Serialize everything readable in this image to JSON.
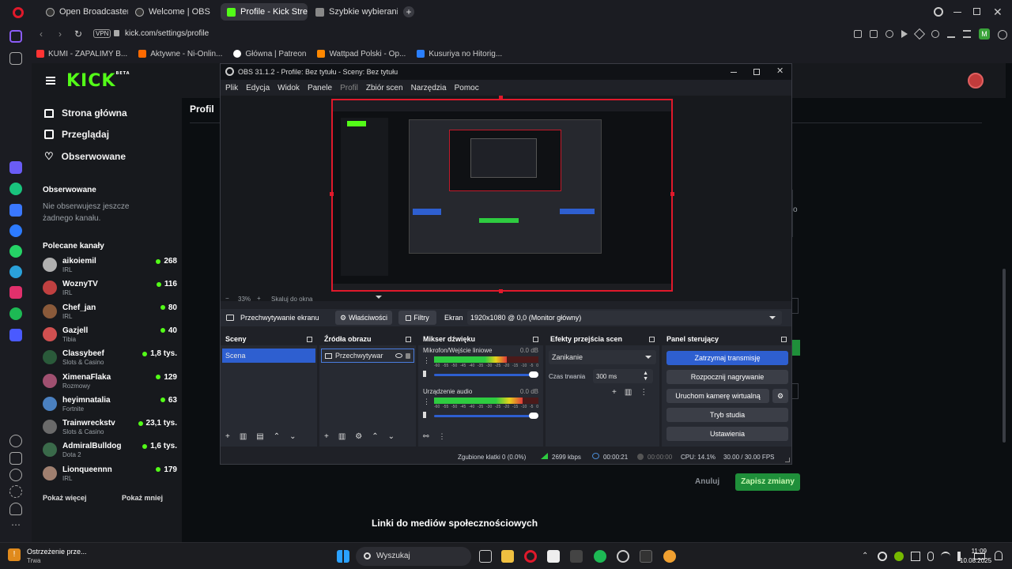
{
  "browser": {
    "tabs": [
      {
        "label": "Open Broadcaster Softw...",
        "active": false
      },
      {
        "label": "Welcome | OBS",
        "active": false
      },
      {
        "label": "Profile - Kick Streaming",
        "active": true
      },
      {
        "label": "Szybkie wybieranie",
        "active": false
      }
    ],
    "url": "kick.com/settings/profile",
    "vpn_label": "VPN",
    "bookmarks": [
      {
        "label": "KUMI - ZAPALIMY B...",
        "color": "#ff3333"
      },
      {
        "label": "Aktywne - Ni-Onlin...",
        "color": "#ff6a00"
      },
      {
        "label": "Główna | Patreon",
        "color": "#ffffff"
      },
      {
        "label": "Wattpad Polski - Op...",
        "color": "#ff8800"
      },
      {
        "label": "Kusuriya no Hitorig...",
        "color": "#2a7fff"
      }
    ]
  },
  "kick": {
    "logo": "KICK",
    "logo_badge": "BETA",
    "nav": [
      {
        "label": "Strona główna",
        "icon": "home-icon"
      },
      {
        "label": "Przeglądaj",
        "icon": "browse-icon"
      },
      {
        "label": "Obserwowane",
        "icon": "heart-icon"
      }
    ],
    "followed_header": "Obserwowane",
    "followed_empty": "Nie obserwujesz jeszcze żadnego kanału.",
    "recommended_header": "Polecane kanały",
    "channels": [
      {
        "name": "aikoiemil",
        "category": "IRL",
        "viewers": "268",
        "color": "#b0b0b0"
      },
      {
        "name": "WoznyTV",
        "category": "IRL",
        "viewers": "116",
        "color": "#c04040"
      },
      {
        "name": "Chef_jan",
        "category": "IRL",
        "viewers": "80",
        "color": "#8a5a3a"
      },
      {
        "name": "Gazjell",
        "category": "Tibia",
        "viewers": "40",
        "color": "#d05050"
      },
      {
        "name": "Classybeef",
        "category": "Slots & Casino",
        "viewers": "1,8 tys.",
        "color": "#2a5a3a"
      },
      {
        "name": "XimenaFlaka",
        "category": "Rozmowy",
        "viewers": "129",
        "color": "#a05070"
      },
      {
        "name": "heyimnatalia",
        "category": "Fortnite",
        "viewers": "63",
        "color": "#4a80c0"
      },
      {
        "name": "Trainwreckstv",
        "category": "Slots & Casino",
        "viewers": "23,1 tys.",
        "color": "#6a6a6a"
      },
      {
        "name": "AdmiralBulldog",
        "category": "Dota 2",
        "viewers": "1,6 tys.",
        "color": "#3a6a4a"
      },
      {
        "name": "Lionqueennn",
        "category": "IRL",
        "viewers": "179",
        "color": "#a08070"
      }
    ],
    "show_more": "Pokaż więcej",
    "show_less": "Pokaż mniej",
    "page_tab": "Profil",
    "cancel": "Anuluj",
    "save": "Zapisz zmiany",
    "social_header": "Linki do mediów społecznościowych",
    "accent": "#53fc18"
  },
  "obs": {
    "title": "OBS 31.1.2 - Profile: Bez tytułu - Sceny: Bez tytułu",
    "menu": [
      "Plik",
      "Edycja",
      "Widok",
      "Panele",
      "Profil",
      "Zbiór scen",
      "Narzędzia",
      "Pomoc"
    ],
    "zoom": "33%",
    "scale": "Skaluj do okna",
    "source_toolbar": {
      "source": "Przechwytywanie ekranu",
      "properties": "Właściwości",
      "filters": "Filtry",
      "screen_label": "Ekran",
      "screen_value": "1920x1080 @ 0,0 (Monitor główny)"
    },
    "docks": {
      "scenes": {
        "title": "Sceny",
        "items": [
          "Scena"
        ]
      },
      "sources": {
        "title": "Źródła obrazu",
        "items": [
          "Przechwytywar"
        ]
      },
      "mixer": {
        "title": "Mikser dźwięku",
        "channels": [
          {
            "name": "Mikrofon/Wejście liniowe",
            "db": "0.0 dB",
            "level": 0.7
          },
          {
            "name": "Urządzenie audio",
            "db": "0.0 dB",
            "level": 0.85
          }
        ],
        "scale": [
          "-60",
          "-55",
          "-50",
          "-45",
          "-40",
          "-35",
          "-30",
          "-25",
          "-20",
          "-15",
          "-10",
          "-5",
          "0"
        ]
      },
      "transitions": {
        "title": "Efekty przejścia scen",
        "type": "Zanikanie",
        "duration_label": "Czas trwania",
        "duration": "300 ms"
      },
      "controls": {
        "title": "Panel sterujący",
        "stop_stream": "Zatrzymaj transmisję",
        "record": "Rozpocznij nagrywanie",
        "virtual_cam": "Uruchom kamerę wirtualną",
        "studio": "Tryb studia",
        "settings": "Ustawienia"
      }
    },
    "status": {
      "dropped": "Zgubione klatki 0 (0.0%)",
      "bitrate": "2699 kbps",
      "stream_time": "00:00:21",
      "rec_time": "00:00:00",
      "cpu": "CPU: 14.1%",
      "fps": "30.00 / 30.00 FPS"
    }
  },
  "taskbar": {
    "search": "Wyszukaj",
    "notif_title": "Ostrzeżenie prze...",
    "notif_sub": "Trwa",
    "time": "11:09",
    "date": "10.08.2025"
  }
}
